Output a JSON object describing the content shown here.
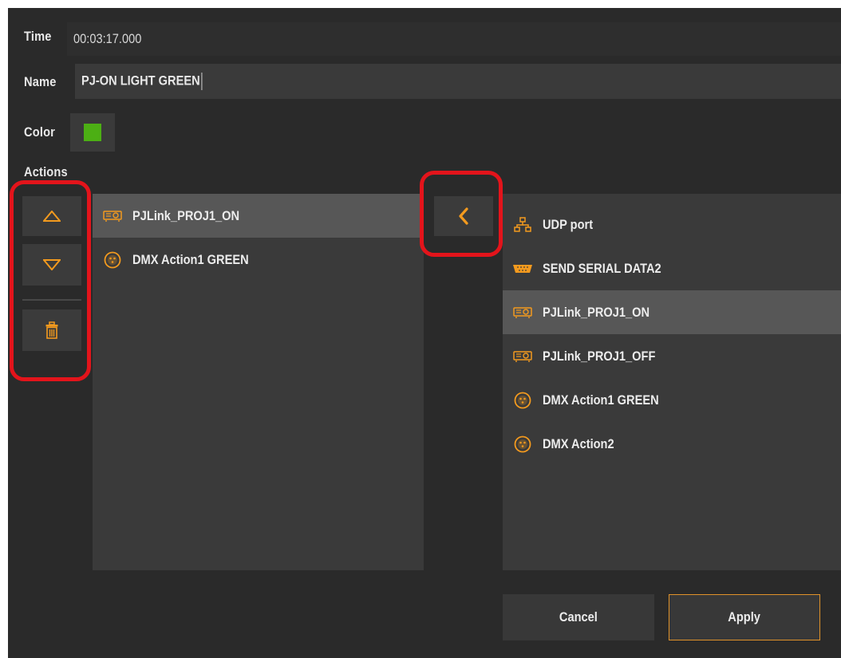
{
  "form": {
    "time_label": "Time",
    "time_value": "00:03:17.000",
    "name_label": "Name",
    "name_value": "PJ-ON LIGHT GREEN",
    "color_label": "Color",
    "color_value": "#4caf14",
    "actions_label": "Actions"
  },
  "accent_color": "#f39a1e",
  "highlight_color": "#e3141b",
  "reorder": {
    "move_up": "triangle-up-icon",
    "move_down": "triangle-down-icon",
    "delete": "trash-icon"
  },
  "assigned_actions": [
    {
      "label": "PJLink_PROJ1_ON",
      "icon": "projector-icon",
      "selected": true
    },
    {
      "label": "DMX Action1 GREEN",
      "icon": "dmx-icon",
      "selected": false
    }
  ],
  "add_button_icon": "chevron-left-icon",
  "available_actions": [
    {
      "label": "UDP port",
      "icon": "network-icon",
      "selected": false
    },
    {
      "label": "SEND SERIAL DATA2",
      "icon": "serial-port-icon",
      "selected": false
    },
    {
      "label": "PJLink_PROJ1_ON",
      "icon": "projector-icon",
      "selected": true
    },
    {
      "label": "PJLink_PROJ1_OFF",
      "icon": "projector-icon",
      "selected": false
    },
    {
      "label": "DMX Action1 GREEN",
      "icon": "dmx-icon",
      "selected": false
    },
    {
      "label": "DMX Action2",
      "icon": "dmx-icon",
      "selected": false
    }
  ],
  "buttons": {
    "cancel": "Cancel",
    "apply": "Apply"
  }
}
